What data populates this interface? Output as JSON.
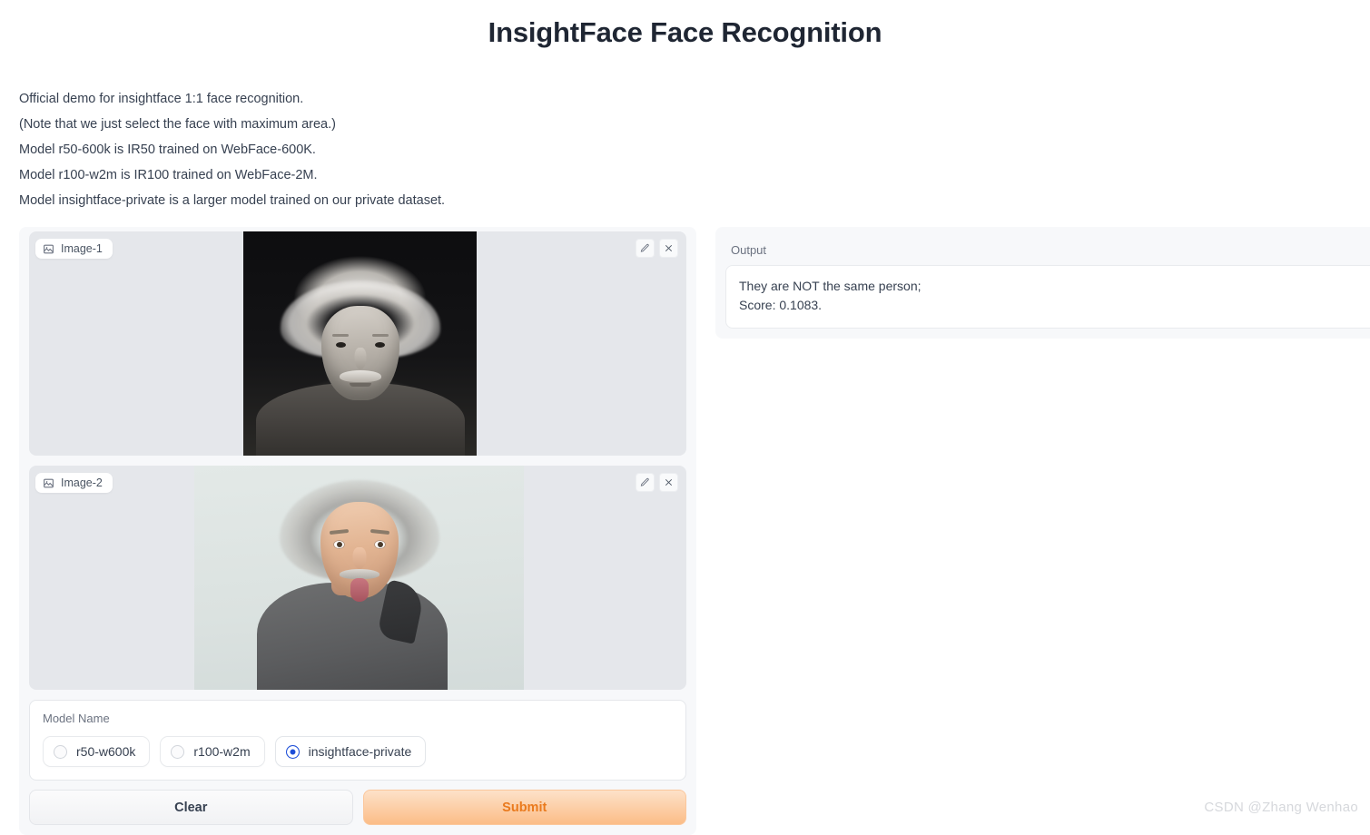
{
  "header": {
    "title": "InsightFace Face Recognition"
  },
  "description": {
    "lines": [
      "Official demo for insightface 1:1 face recognition.",
      "(Note that we just select the face with maximum area.)",
      "Model r50-600k is IR50 trained on WebFace-600K.",
      "Model r100-w2m is IR100 trained on WebFace-2M.",
      "Model insightface-private is a larger model trained on our private dataset."
    ]
  },
  "inputs": {
    "image1": {
      "tag_label": "Image-1",
      "tag_icon": "image-icon",
      "edit_icon": "pencil-icon",
      "clear_icon": "close-icon",
      "alt": "Black and white portrait photograph of Albert Einstein"
    },
    "image2": {
      "tag_label": "Image-2",
      "tag_icon": "image-icon",
      "edit_icon": "pencil-icon",
      "clear_icon": "close-icon",
      "alt": "Color photograph of an Einstein lookalike sticking out his tongue"
    }
  },
  "model_name": {
    "label": "Model Name",
    "selected": "insightface-private",
    "options": [
      {
        "label": "r50-w600k",
        "selected": false
      },
      {
        "label": "r100-w2m",
        "selected": false
      },
      {
        "label": "insightface-private",
        "selected": true
      }
    ]
  },
  "actions": {
    "clear_label": "Clear",
    "submit_label": "Submit"
  },
  "output": {
    "label": "Output",
    "line1": "They are NOT the same person;",
    "line2": "Score: 0.1083."
  },
  "watermark": {
    "text": "CSDN @Zhang Wenhao"
  },
  "colors": {
    "accent_radio": "#1d4ed8",
    "submit_text": "#ea7a1d",
    "submit_bg_top": "#fde2c9",
    "submit_bg_bottom": "#fbbd87",
    "panel_bg": "#f7f8fa",
    "image_bg": "#e5e7eb",
    "text": "#374151",
    "muted_text": "#6b7280",
    "title": "#1f2633"
  }
}
